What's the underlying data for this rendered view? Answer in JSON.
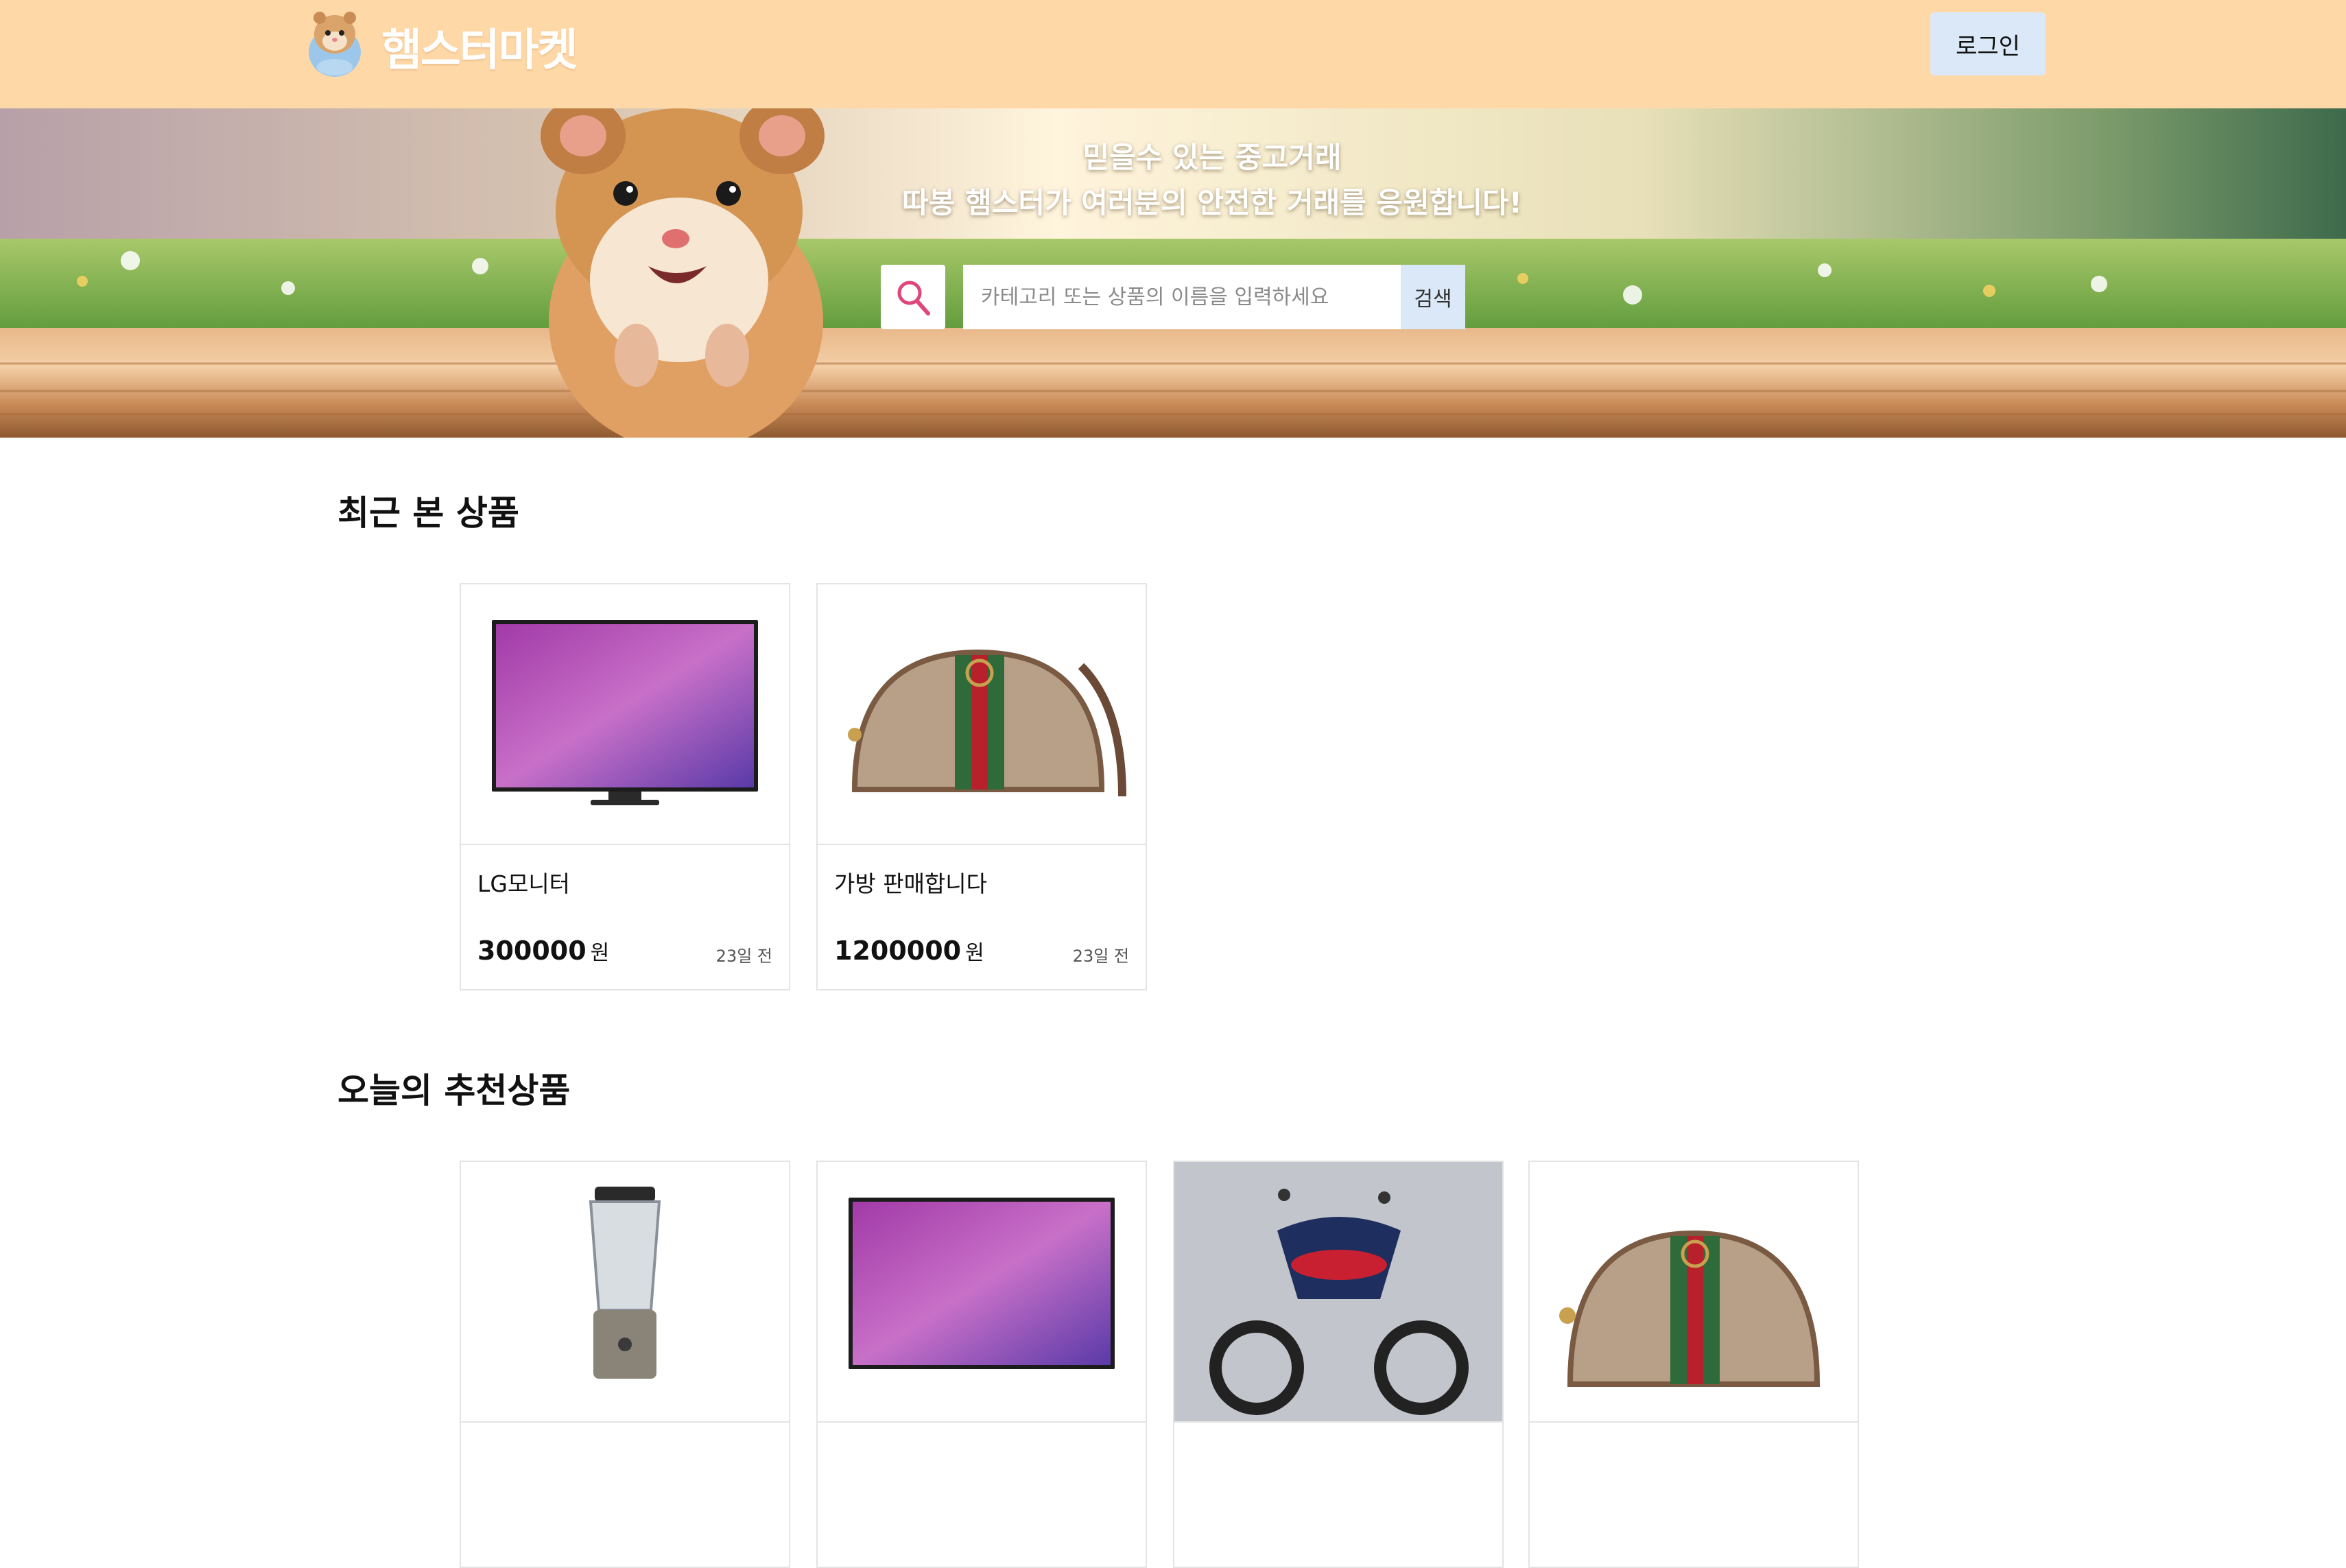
{
  "header": {
    "logo_text": "햄스터마켓",
    "login_label": "로그인"
  },
  "banner": {
    "line1": "믿을수 있는 중고거래",
    "line2": "따봉 햄스터가 여러분의 안전한 거래를 응원합니다!",
    "search_placeholder": "카테고리 또는 상품의 이름을 입력하세요",
    "search_button": "검색"
  },
  "recent": {
    "title": "최근 본 상품",
    "items": [
      {
        "title": "LG모니터",
        "price": "300000",
        "unit": "원",
        "time": "23일 전",
        "image": "tv"
      },
      {
        "title": "가방 판매합니다",
        "price": "1200000",
        "unit": "원",
        "time": "23일 전",
        "image": "bag"
      }
    ]
  },
  "recommended": {
    "title": "오늘의 추천상품",
    "items": [
      {
        "image": "blender"
      },
      {
        "image": "tv"
      },
      {
        "image": "scooter"
      },
      {
        "image": "bag"
      }
    ]
  },
  "colors": {
    "header_bg": "#ffd8a8",
    "button_bg": "#dbe8f8",
    "search_icon": "#e0457b"
  }
}
